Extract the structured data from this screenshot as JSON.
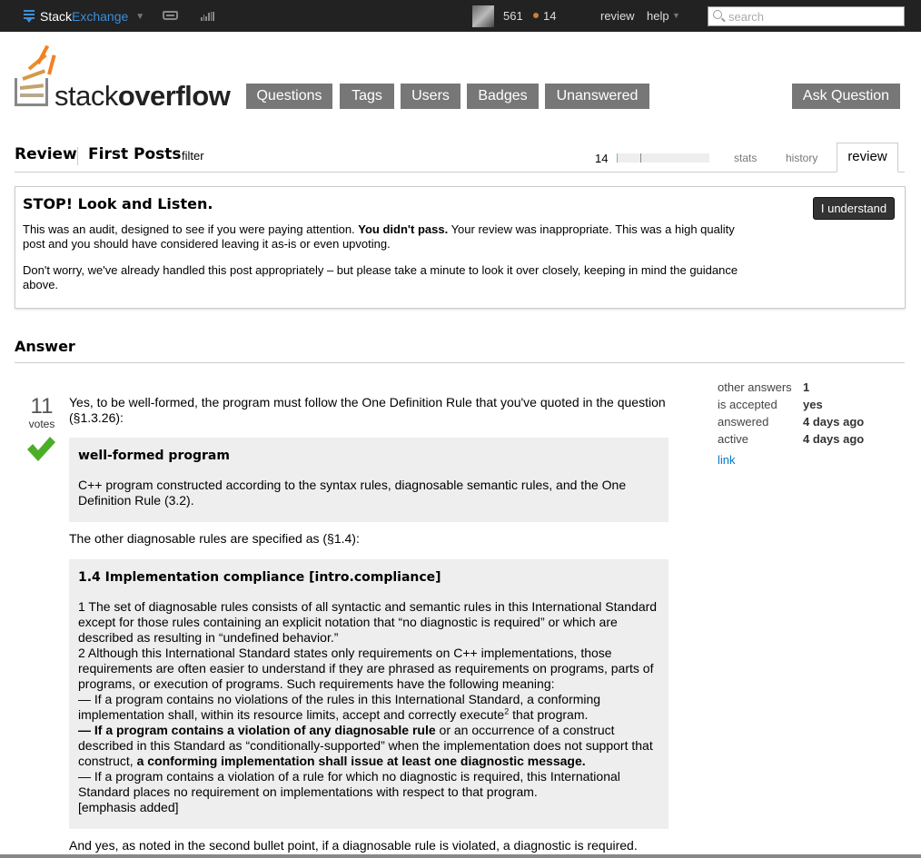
{
  "topbar": {
    "brand_prefix": "Stack",
    "brand_suffix": "Exchange",
    "reputation": "561",
    "bronze_badges": "14",
    "review_link": "review",
    "help_link": "help",
    "search_placeholder": "search",
    "icons": [
      "stackexchange-icon",
      "inbox-icon",
      "achievements-icon",
      "search-icon"
    ]
  },
  "header": {
    "logo_light": "stack",
    "logo_bold": "overflow",
    "nav": [
      "Questions",
      "Tags",
      "Users",
      "Badges",
      "Unanswered"
    ],
    "ask_button": "Ask Question"
  },
  "subheader": {
    "title": "Review",
    "queue": "First Posts",
    "filter": "filter",
    "reviews_count": "14",
    "progress_fraction": 0.25,
    "tabs": [
      "stats",
      "history",
      "review"
    ],
    "active_tab": "review"
  },
  "audit": {
    "title": "STOP! Look and Listen.",
    "p1_before": "This was an audit, designed to see if you were paying attention. ",
    "p1_bold": "You didn't pass.",
    "p1_after": " Your review was inappropriate. This was a high quality post and you should have considered leaving it as-is or even upvoting.",
    "p2": "Don't worry, we've already handled this post appropriately – but please take a minute to look it over closely, keeping in mind the guidance above.",
    "button": "I understand"
  },
  "answer": {
    "heading": "Answer",
    "votes": "11",
    "votes_label": "votes",
    "accepted": true,
    "intro": "Yes, to be well-formed, the program must follow the One Definition Rule that you've quoted in the question (§1.3.26):",
    "quote1_title": "well-formed program",
    "quote1_body": "C++ program constructed according to the syntax rules, diagnosable semantic rules, and the One Definition Rule (3.2).",
    "middle": "The other diagnosable rules are specified as (§1.4):",
    "quote2_title": "1.4 Implementation compliance [intro.compliance]",
    "quote2_p1": "1 The set of diagnosable rules consists of all syntactic and semantic rules in this International Standard except for those rules containing an explicit notation that “no diagnostic is required” or which are described as resulting in “undefined behavior.”",
    "quote2_p2": "2 Although this International Standard states only requirements on C++ implementations, those requirements are often easier to understand if they are phrased as requirements on programs, parts of programs, or execution of programs. Such requirements have the following meaning:",
    "quote2_b1_before": "— If a program contains no violations of the rules in this International Standard, a conforming implementation shall, within its resource limits, accept and correctly execute",
    "quote2_b1_sup": "2",
    "quote2_b1_after": " that program.",
    "quote2_b2_bold1": "— If a program contains a violation of any diagnosable rule",
    "quote2_b2_mid": " or an occurrence of a construct described in this Standard as “conditionally-supported” when the implementation does not support that construct, ",
    "quote2_b2_bold2": "a conforming implementation shall issue at least one diagnostic message.",
    "quote2_b3": "— If a program contains a violation of a rule for which no diagnostic is required, this International Standard places no requirement on implementations with respect to that program.",
    "quote2_note": "[emphasis added]",
    "outro": "And yes, as noted in the second bullet point, if a diagnosable rule is violated, a diagnostic is required."
  },
  "meta": {
    "rows": [
      {
        "label": "other answers",
        "value": "1"
      },
      {
        "label": "is accepted",
        "value": "yes"
      },
      {
        "label": "answered",
        "value": "4 days ago"
      },
      {
        "label": "active",
        "value": "4 days ago"
      }
    ],
    "link": "link"
  },
  "colors": {
    "topbar": "#222222",
    "brand_blue": "#3a8fd9",
    "nav_button": "#777777",
    "accepted_green": "#4cae27",
    "link_blue": "#0077cc",
    "quote_bg": "#eeeeee"
  }
}
